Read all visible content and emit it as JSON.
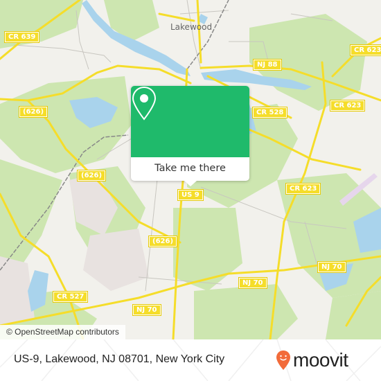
{
  "map": {
    "town_label": "Lakewood",
    "road_shields": [
      {
        "label": "CR 639"
      },
      {
        "label": "NJ 88"
      },
      {
        "label": "CR 623"
      },
      {
        "label": "(626)"
      },
      {
        "label": "CR 528"
      },
      {
        "label": "CR 623"
      },
      {
        "label": "(626)"
      },
      {
        "label": "US 9"
      },
      {
        "label": "CR 623"
      },
      {
        "label": "(626)"
      },
      {
        "label": "NJ 70"
      },
      {
        "label": "CR 527"
      },
      {
        "label": "NJ 70"
      },
      {
        "label": "NJ 70"
      }
    ],
    "attribution": "© OpenStreetMap contributors",
    "colors": {
      "land": "#f2f1ec",
      "forest": "#cde6b0",
      "water": "#a9d3ec",
      "road": "#f5dd2a",
      "residential": "#e8e2e0"
    }
  },
  "popup": {
    "icon": "map-pin-icon",
    "button_label": "Take me there",
    "accent": "#1fba6b"
  },
  "footer": {
    "address": "US-9, Lakewood, NJ 08701, New York City",
    "brand": "moovit",
    "brand_color": "#f26b3a"
  }
}
